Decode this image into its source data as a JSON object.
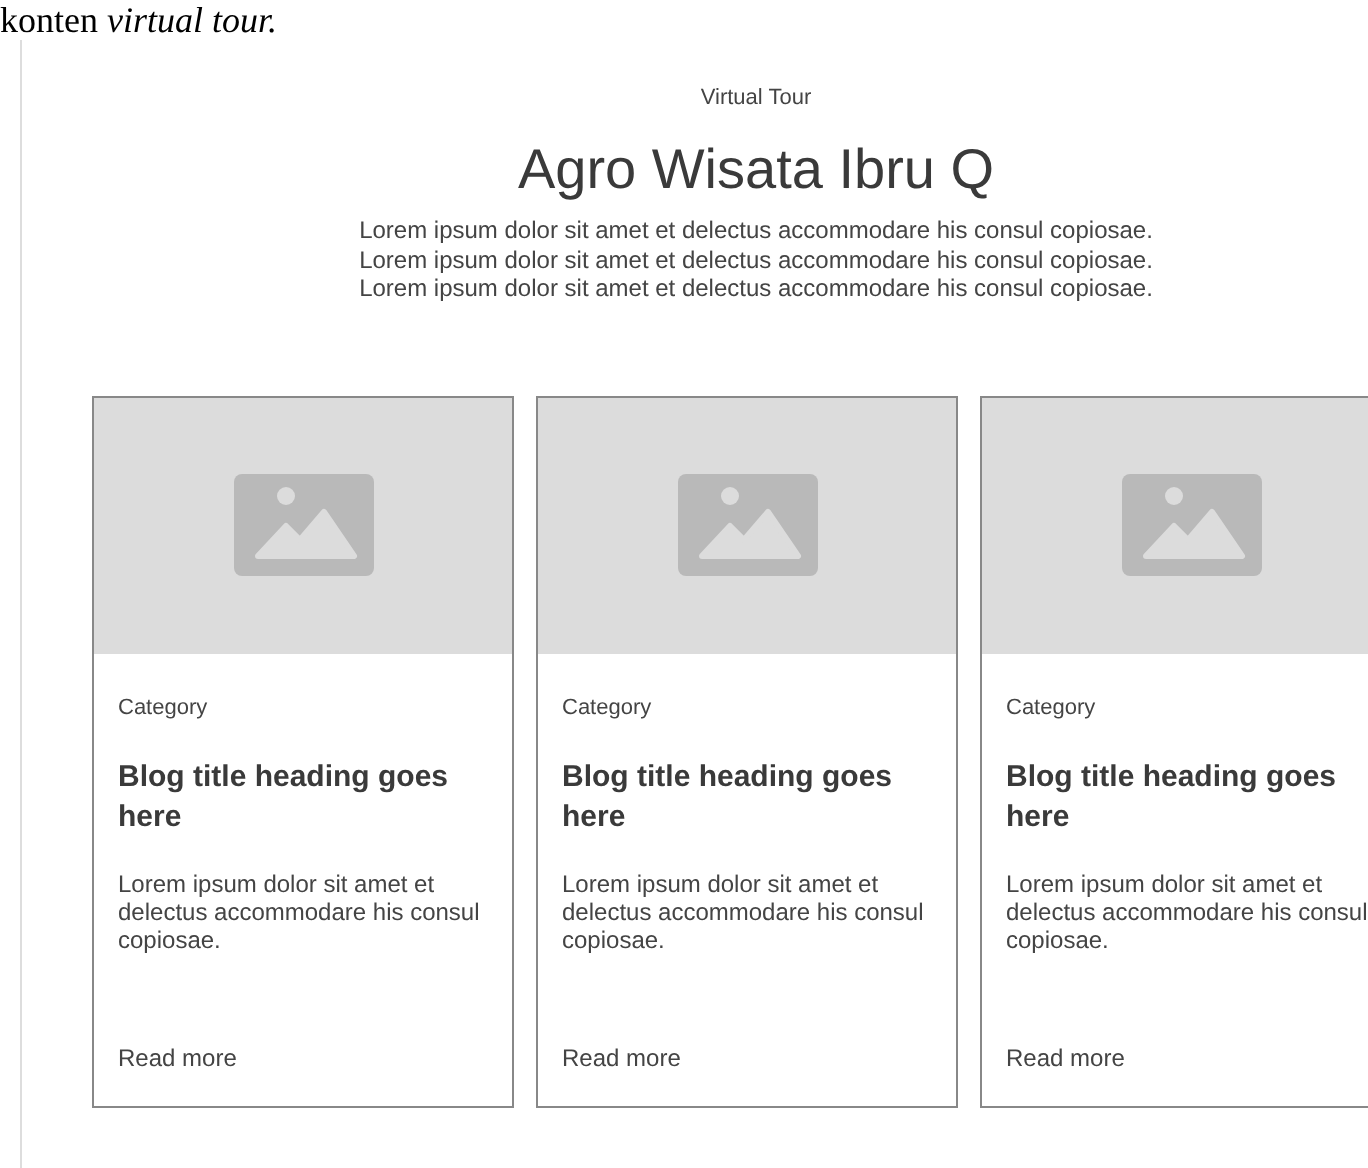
{
  "document_text": "konten *virtual tour.*",
  "section": {
    "eyebrow": "Virtual Tour",
    "title": "Agro Wisata Ibru Q",
    "description": "Lorem ipsum dolor sit amet et delectus accommodare his consul copiosae. Lorem ipsum dolor sit amet et delectus accommodare his consul copiosae. Lorem ipsum dolor sit amet et delectus accommodare his consul copiosae."
  },
  "cards": [
    {
      "category": "Category",
      "title": "Blog title heading goes here",
      "excerpt": "Lorem ipsum dolor sit amet et delectus accommodare his consul copiosae.",
      "link": "Read more"
    },
    {
      "category": "Category",
      "title": "Blog title heading goes here",
      "excerpt": "Lorem ipsum dolor sit amet et delectus accommodare his consul copiosae.",
      "link": "Read more"
    },
    {
      "category": "Category",
      "title": "Blog title heading goes here",
      "excerpt": "Lorem ipsum dolor sit amet et delectus accommodare his consul copiosae.",
      "link": "Read more"
    }
  ]
}
